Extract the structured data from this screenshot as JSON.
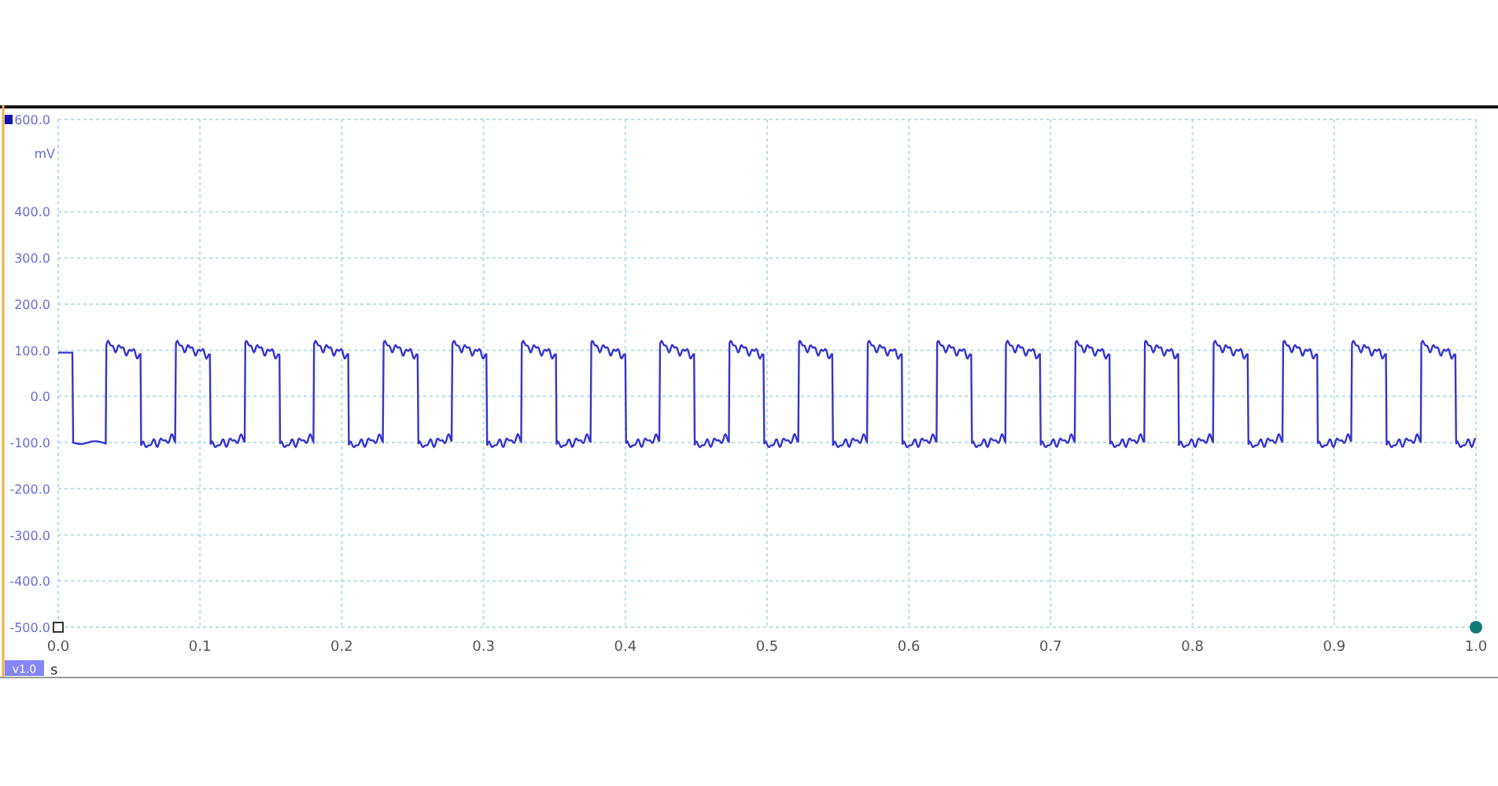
{
  "plot": {
    "y_unit": "mV",
    "y_ticks": [
      "600.0",
      "400.0",
      "300.0",
      "200.0",
      "100.0",
      "0.0",
      "-100.0",
      "-200.0",
      "-300.0",
      "-400.0",
      "-500.0"
    ],
    "x_ticks": [
      "0.0",
      "0.1",
      "0.2",
      "0.3",
      "0.4",
      "0.5",
      "0.6",
      "0.7",
      "0.8",
      "0.9",
      "1.0"
    ],
    "x_unit": "s",
    "scale_badge": "v1.0"
  }
}
